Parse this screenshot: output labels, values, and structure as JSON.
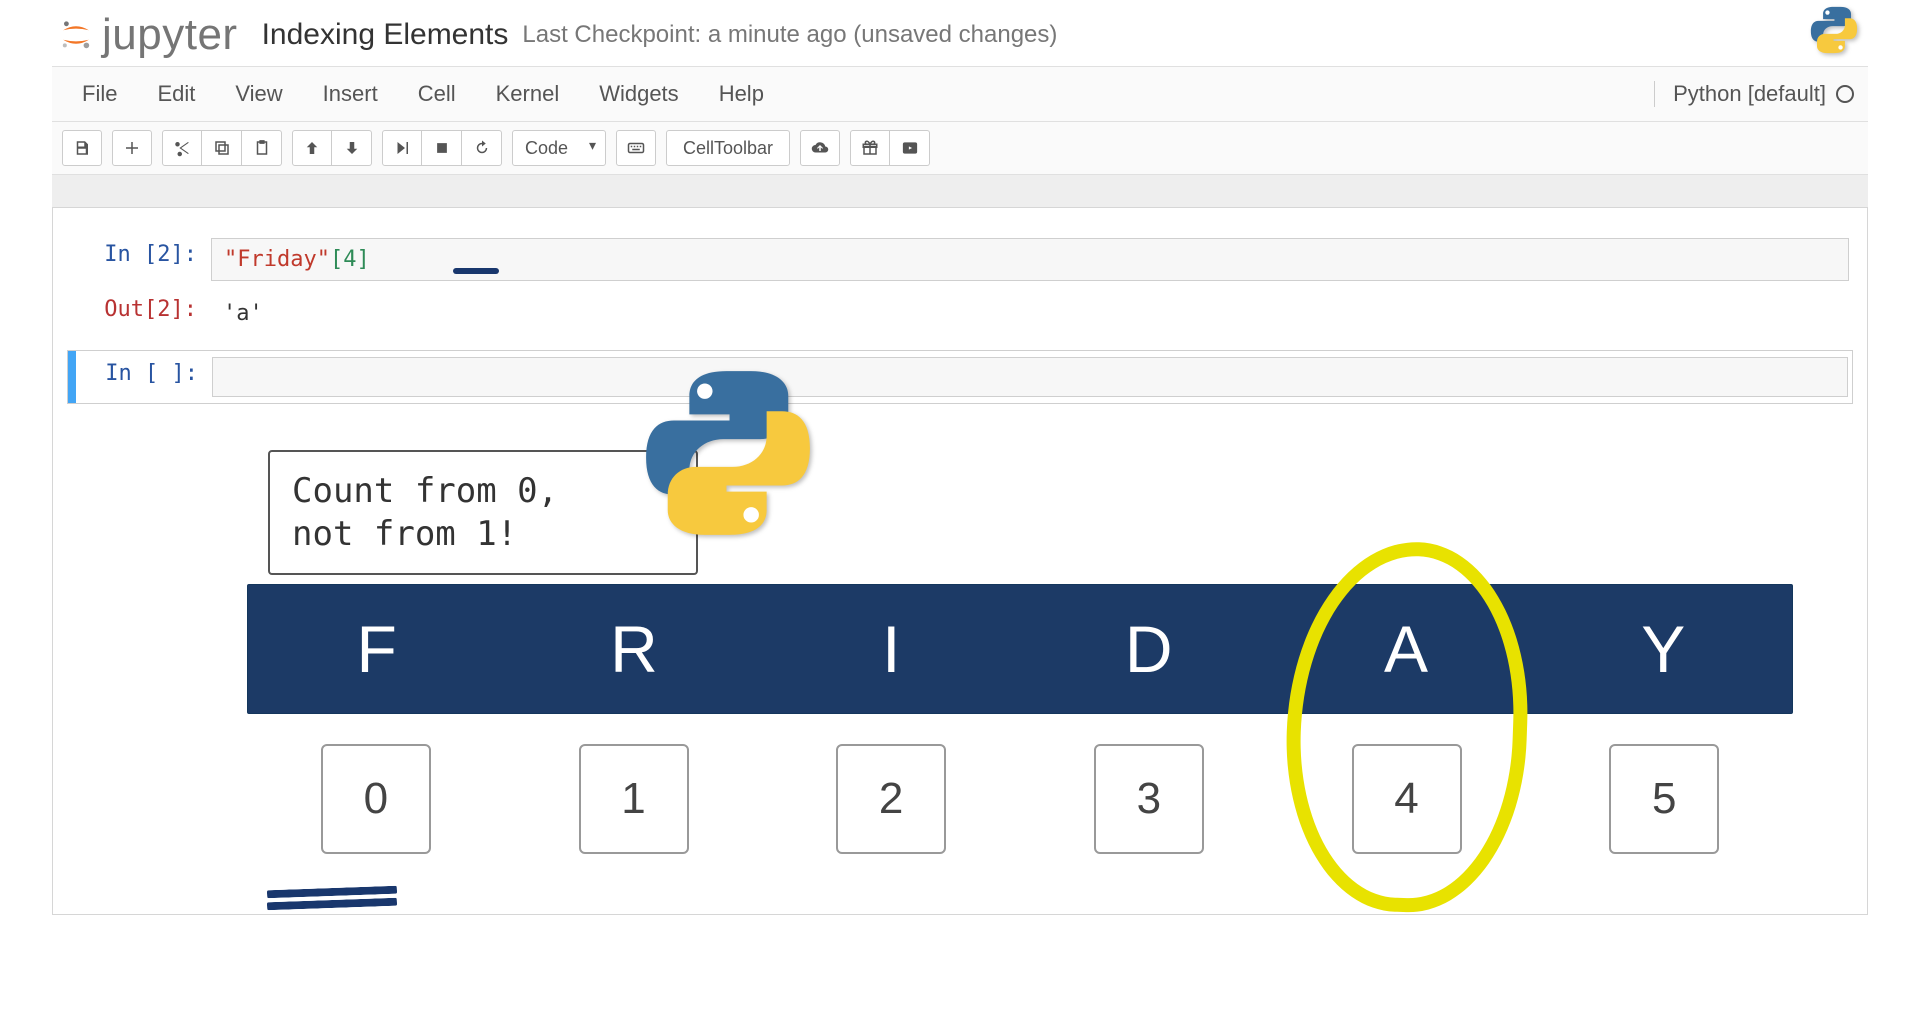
{
  "header": {
    "logo_text": "jupyter",
    "title": "Indexing Elements",
    "checkpoint": "Last Checkpoint: a minute ago (unsaved changes)"
  },
  "menu": [
    "File",
    "Edit",
    "View",
    "Insert",
    "Cell",
    "Kernel",
    "Widgets",
    "Help"
  ],
  "kernel_label": "Python [default]",
  "toolbar": {
    "cell_type": "Code",
    "cell_toolbar": "CellToolbar"
  },
  "cells": {
    "c1": {
      "in_prompt": "In [2]:",
      "code_string": "\"Friday\"",
      "code_bracket_open": "[",
      "code_index": "4",
      "code_bracket_close": "]",
      "out_prompt": "Out[2]:",
      "out_value": "'a'"
    },
    "c2": {
      "in_prompt": "In [ ]:"
    }
  },
  "tip_line1": "Count from 0,",
  "tip_line2": "not from 1!",
  "diagram": {
    "letters": [
      "F",
      "R",
      "I",
      "D",
      "A",
      "Y"
    ],
    "indices": [
      "0",
      "1",
      "2",
      "3",
      "4",
      "5"
    ],
    "highlight_index": 4
  }
}
